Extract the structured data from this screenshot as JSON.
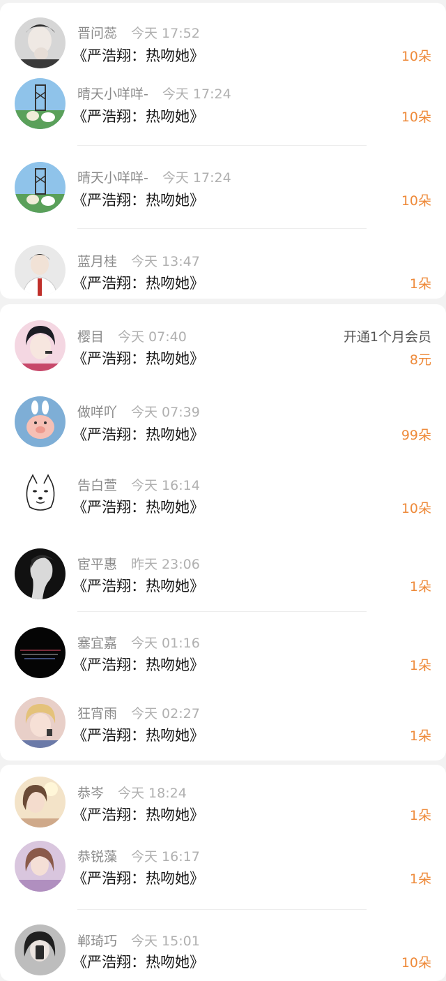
{
  "colors": {
    "background": "#f2f2f2",
    "card": "#ffffff",
    "name": "#8a8a8a",
    "time": "#b0b0b0",
    "work_title": "#1a1a1a",
    "gift_accent": "#ee8a3a"
  },
  "records": [
    {
      "user": "晋问蕊",
      "time": "今天 17:52",
      "work": "《严浩翔：热吻她》",
      "gift": "10朵",
      "avatar": "avatar-boy-hand-icon"
    },
    {
      "user": "晴天小咩咩-",
      "time": "今天 17:24",
      "work": "《严浩翔：热吻她》",
      "gift": "10朵",
      "avatar": "avatar-tower-dog-icon"
    },
    {
      "user": "晴天小咩咩-",
      "time": "今天 17:24",
      "work": "《严浩翔：热吻她》",
      "gift": "10朵",
      "avatar": "avatar-tower-dog-icon"
    },
    {
      "user": "蓝月桂",
      "time": "今天 13:47",
      "work": "《严浩翔：热吻她》",
      "gift": "1朵",
      "avatar": "avatar-boy-school-uniform-icon"
    },
    {
      "user": "樱目",
      "time": "今天 07:40",
      "work": "《严浩翔：热吻她》",
      "note": "开通1个月会员",
      "gift": "8元",
      "avatar": "avatar-idol-mic-icon"
    },
    {
      "user": "做咩吖",
      "time": "今天 07:39",
      "work": "《严浩翔：热吻她》",
      "gift": "99朵",
      "avatar": "avatar-pig-toy-icon"
    },
    {
      "user": "告白萱",
      "time": "今天 16:14",
      "work": "《严浩翔：热吻她》",
      "gift": "10朵",
      "avatar": "avatar-doge-sketch-icon"
    },
    {
      "user": "宦平惠",
      "time": "昨天 23:06",
      "work": "《严浩翔：热吻她》",
      "gift": "1朵",
      "avatar": "avatar-dark-profile-icon"
    },
    {
      "user": "塞宜嘉",
      "time": "今天 01:16",
      "work": "《严浩翔：热吻她》",
      "gift": "1朵",
      "avatar": "avatar-black-text-icon"
    },
    {
      "user": "狂宵雨",
      "time": "今天 02:27",
      "work": "《严浩翔：热吻她》",
      "gift": "1朵",
      "avatar": "avatar-blond-boy-icon"
    },
    {
      "user": "恭岑",
      "time": "今天 18:24",
      "work": "《严浩翔：热吻她》",
      "gift": "1朵",
      "avatar": "avatar-girl-sun-icon"
    },
    {
      "user": "恭锐藻",
      "time": "今天 16:17",
      "work": "《严浩翔：热吻她》",
      "gift": "1朵",
      "avatar": "avatar-girl-dream-icon"
    },
    {
      "user": "郸琦巧",
      "time": "今天 15:01",
      "work": "《严浩翔：热吻她》",
      "gift": "10朵",
      "avatar": "avatar-girl-phone-icon"
    }
  ]
}
